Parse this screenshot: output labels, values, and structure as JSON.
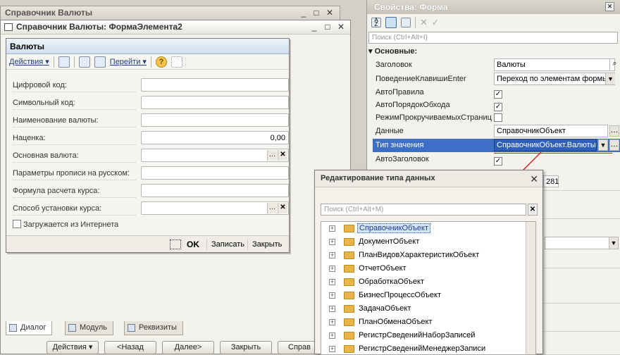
{
  "back_window": {
    "title": "Справочник Валюты"
  },
  "form_window": {
    "title": "Справочник Валюты: ФормаЭлемента2"
  },
  "form": {
    "title": "Валюты",
    "toolbar": {
      "actions": "Действия",
      "goto": "Перейти"
    },
    "fields": [
      {
        "label": "Цифровой код:",
        "value": ""
      },
      {
        "label": "Символьный код:",
        "value": ""
      },
      {
        "label": "Наименование валюты:",
        "value": ""
      },
      {
        "label": "Наценка:",
        "value": "0,00"
      },
      {
        "label": "Основная валюта:",
        "value": ""
      },
      {
        "label": "Параметры прописи на русском:",
        "value": ""
      },
      {
        "label": "Формула расчета курса:",
        "value": ""
      },
      {
        "label": "Способ установки курса:",
        "value": ""
      }
    ],
    "checkbox_label": "Загружается из Интернета",
    "buttons": {
      "ok": "OK",
      "save": "Записать",
      "close": "Закрыть"
    }
  },
  "tabs": [
    "Диалог",
    "Модуль",
    "Реквизиты"
  ],
  "bottom_buttons": {
    "actions": "Действия",
    "back": "<Назад",
    "next": "Далее>",
    "close": "Закрыть",
    "reference": "Справ"
  },
  "properties": {
    "title": "Свойства: Форма",
    "search_placeholder": "Поиск (Ctrl+Alt+I)",
    "group": "Основные:",
    "rows": [
      {
        "label": "Заголовок",
        "value": "Валюты"
      },
      {
        "label": "ПоведениеКлавишиEnter",
        "value": "Переход по элементам формы"
      },
      {
        "label": "АвтоПравила",
        "checked": true
      },
      {
        "label": "АвтоПорядокОбхода",
        "checked": true
      },
      {
        "label": "РежимПрокручиваемыхСтраниц",
        "checked": false
      },
      {
        "label": "Данные",
        "value": "СправочникОбъект"
      },
      {
        "label": "Тип значения",
        "value": "СправочникОбъект.Валюты"
      },
      {
        "label": "АвтоЗаголовок",
        "checked": true
      }
    ],
    "partial_value": "281"
  },
  "type_dialog": {
    "title": "Редактирование типа данных",
    "search_placeholder": "Поиск (Ctrl+Alt+M)",
    "items": [
      "СправочникОбъект",
      "ДокументОбъект",
      "ПланВидовХарактеристикОбъект",
      "ОтчетОбъект",
      "ОбработкаОбъект",
      "БизнесПроцессОбъект",
      "ЗадачаОбъект",
      "ПланОбменаОбъект",
      "РегистрСведенийНаборЗаписей",
      "РегистрСведенийМенеджерЗаписи"
    ]
  },
  "colors": {
    "selection": "#3d6fc7",
    "arrow": "#e0201e",
    "folder": "#e9b548"
  }
}
